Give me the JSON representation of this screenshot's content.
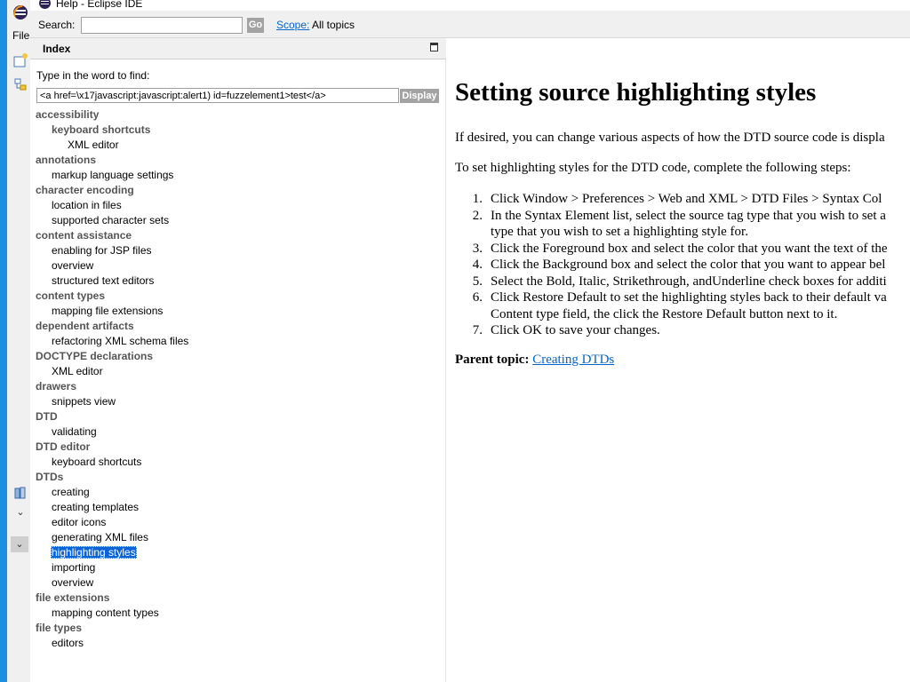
{
  "window": {
    "title": "Help - Eclipse IDE",
    "bg_menu_file": "File"
  },
  "search": {
    "label": "Search:",
    "value": "",
    "go_label": "Go",
    "scope_link": "Scope:",
    "scope_value": "All topics"
  },
  "index": {
    "title": "Index",
    "find_label": "Type in the word to find:",
    "input_value": "<a href=\\x17javascript:javascript:alert1) id=fuzzelement1>test</a>",
    "display_label": "Display",
    "items": [
      {
        "label": "accessibility",
        "level": 0
      },
      {
        "label": "keyboard shortcuts",
        "level": 1,
        "bold": true
      },
      {
        "label": "XML editor",
        "level": 2
      },
      {
        "label": "annotations",
        "level": 0
      },
      {
        "label": "markup language settings",
        "level": 1
      },
      {
        "label": "character encoding",
        "level": 0
      },
      {
        "label": "location in files",
        "level": 1
      },
      {
        "label": "supported character sets",
        "level": 1
      },
      {
        "label": "content assistance",
        "level": 0
      },
      {
        "label": "enabling for JSP files",
        "level": 1
      },
      {
        "label": "overview",
        "level": 1
      },
      {
        "label": "structured text editors",
        "level": 1
      },
      {
        "label": "content types",
        "level": 0
      },
      {
        "label": "mapping file extensions",
        "level": 1
      },
      {
        "label": "dependent artifacts",
        "level": 0
      },
      {
        "label": "refactoring XML schema files",
        "level": 1
      },
      {
        "label": "DOCTYPE declarations",
        "level": 0
      },
      {
        "label": "XML editor",
        "level": 1
      },
      {
        "label": "drawers",
        "level": 0
      },
      {
        "label": "snippets view",
        "level": 1
      },
      {
        "label": "DTD",
        "level": 0
      },
      {
        "label": "validating",
        "level": 1
      },
      {
        "label": "DTD editor",
        "level": 0
      },
      {
        "label": "keyboard shortcuts",
        "level": 1
      },
      {
        "label": "DTDs",
        "level": 0
      },
      {
        "label": "creating",
        "level": 1
      },
      {
        "label": "creating templates",
        "level": 1
      },
      {
        "label": "editor icons",
        "level": 1
      },
      {
        "label": "generating XML files",
        "level": 1
      },
      {
        "label": "highlighting styles",
        "level": 1,
        "selected": true
      },
      {
        "label": "importing",
        "level": 1
      },
      {
        "label": "overview",
        "level": 1
      },
      {
        "label": "file extensions",
        "level": 0
      },
      {
        "label": "mapping content types",
        "level": 1
      },
      {
        "label": "file types",
        "level": 0
      },
      {
        "label": "editors",
        "level": 1
      }
    ]
  },
  "content": {
    "title": "Setting source highlighting styles",
    "intro": "If desired, you can change various aspects of how the DTD source code is displa",
    "steps_intro": "To set highlighting styles for the DTD code, complete the following steps:",
    "steps": [
      {
        "num": "1.",
        "lines": [
          "Click Window > Preferences > Web and XML > DTD Files > Syntax Col"
        ]
      },
      {
        "num": "2.",
        "lines": [
          "In the Syntax Element list, select the source tag type that you wish to set a",
          "type that you wish to set a highlighting style for."
        ]
      },
      {
        "num": "3.",
        "lines": [
          "Click the Foreground box and select the color that you want the text of the"
        ]
      },
      {
        "num": "4.",
        "lines": [
          "Click the Background box and select the color that you want to appear bel"
        ]
      },
      {
        "num": "5.",
        "lines": [
          "Select the Bold, Italic, Strikethrough, andUnderline check boxes for additi"
        ]
      },
      {
        "num": "6.",
        "lines": [
          "Click Restore Default to set the highlighting styles back to their default va",
          "Content type field, the click the Restore Default button next to it."
        ]
      },
      {
        "num": "7.",
        "lines": [
          "Click OK to save your changes."
        ]
      }
    ],
    "parent_label": "Parent topic:",
    "parent_link": "Creating DTDs"
  },
  "colors": {
    "selection": "#0a64d6",
    "link": "#0066cc",
    "category_text": "#555555",
    "button_gray": "#a3a3a3"
  }
}
